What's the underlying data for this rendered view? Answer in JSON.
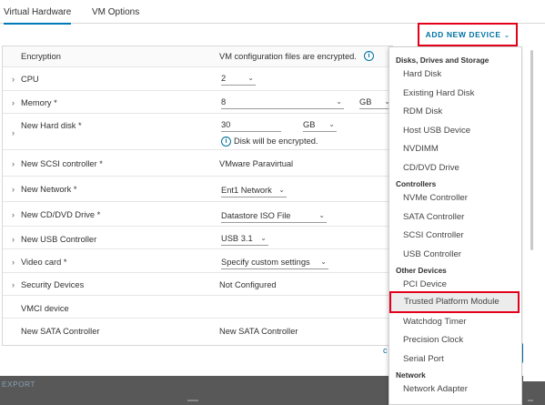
{
  "tabs": {
    "virtual_hardware": "Virtual Hardware",
    "vm_options": "VM Options"
  },
  "add_device": {
    "label": "ADD NEW DEVICE",
    "chevron": "⌄"
  },
  "rows": {
    "encryption": {
      "label": "Encryption",
      "value": "VM configuration files are encrypted."
    },
    "cpu": {
      "label": "CPU",
      "value": "2"
    },
    "memory": {
      "label": "Memory *",
      "value": "8",
      "unit": "GB"
    },
    "hard_disk": {
      "label": "New Hard disk *",
      "value": "30",
      "unit": "GB",
      "note": "Disk will be encrypted."
    },
    "scsi": {
      "label": "New SCSI controller *",
      "value": "VMware Paravirtual"
    },
    "network": {
      "label": "New Network *",
      "value": "Ent1 Network"
    },
    "cd_dvd": {
      "label": "New CD/DVD Drive *",
      "value": "Datastore ISO File"
    },
    "usb": {
      "label": "New USB Controller",
      "value": "USB 3.1"
    },
    "video": {
      "label": "Video card *",
      "value": "Specify custom settings"
    },
    "security": {
      "label": "Security Devices",
      "value": "Not Configured"
    },
    "vmci": {
      "label": "VMCI device"
    },
    "sata": {
      "label": "New SATA Controller",
      "value": "New SATA Controller"
    }
  },
  "menu": {
    "disks_header": "Disks, Drives and Storage",
    "hard_disk": "Hard Disk",
    "existing_hard_disk": "Existing Hard Disk",
    "rdm_disk": "RDM Disk",
    "host_usb": "Host USB Device",
    "nvdimm": "NVDIMM",
    "cd_dvd": "CD/DVD Drive",
    "controllers_header": "Controllers",
    "nvme": "NVMe Controller",
    "sata": "SATA Controller",
    "scsi": "SCSI Controller",
    "usb": "USB Controller",
    "other_header": "Other Devices",
    "pci": "PCI Device",
    "tpm": "Trusted Platform Module",
    "watchdog": "Watchdog Timer",
    "precision_clock": "Precision Clock",
    "serial_port": "Serial Port",
    "network_header": "Network",
    "network_adapter": "Network Adapter"
  },
  "footer": {
    "export": "EXPORT"
  },
  "colors": {
    "accent": "#0072a3",
    "highlight_border": "#e4001b",
    "tab_underline": "#0079b8"
  }
}
